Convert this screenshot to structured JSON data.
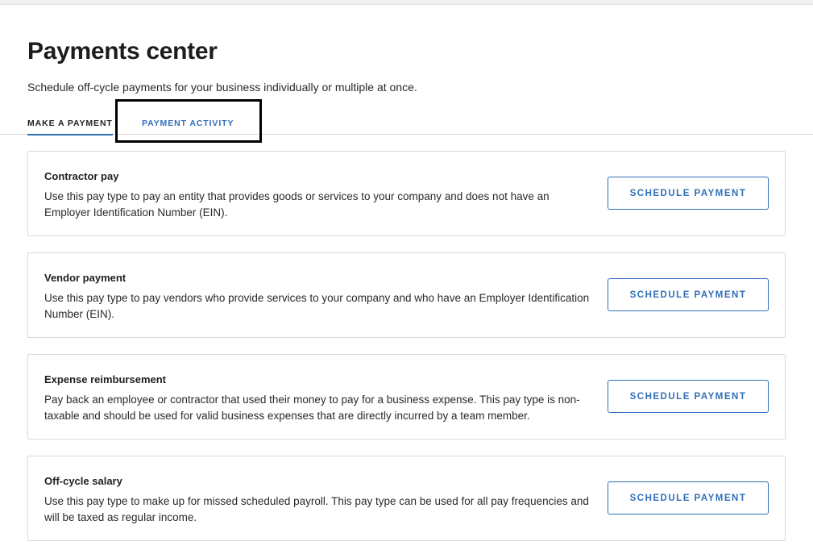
{
  "header": {
    "title": "Payments center",
    "subtitle": "Schedule off-cycle payments for your business individually or multiple at once."
  },
  "tabs": [
    {
      "label": "MAKE A PAYMENT",
      "active": true
    },
    {
      "label": "PAYMENT ACTIVITY",
      "active": false
    }
  ],
  "cards": [
    {
      "title": "Contractor pay",
      "description": "Use this pay type to pay an entity that provides goods or services to your company and does not have an Employer Identification Number (EIN).",
      "button": "SCHEDULE PAYMENT"
    },
    {
      "title": "Vendor payment",
      "description": "Use this pay type to pay vendors who provide services to your company and who have an Employer Identification Number (EIN).",
      "button": "SCHEDULE PAYMENT"
    },
    {
      "title": "Expense reimbursement",
      "description": "Pay back an employee or contractor that used their money to pay for a business expense. This pay type is non-taxable and should be used for valid business expenses that are directly incurred by a team member.",
      "button": "SCHEDULE PAYMENT"
    },
    {
      "title": "Off-cycle salary",
      "description": "Use this pay type to make up for missed scheduled payroll. This pay type can be used for all pay frequencies and will be taxed as regular income.",
      "button": "SCHEDULE PAYMENT"
    }
  ],
  "colors": {
    "accent": "#2f6fb8",
    "tab_underline": "#2b6cb0",
    "border": "#d9d9d9",
    "highlight": "#000000"
  }
}
